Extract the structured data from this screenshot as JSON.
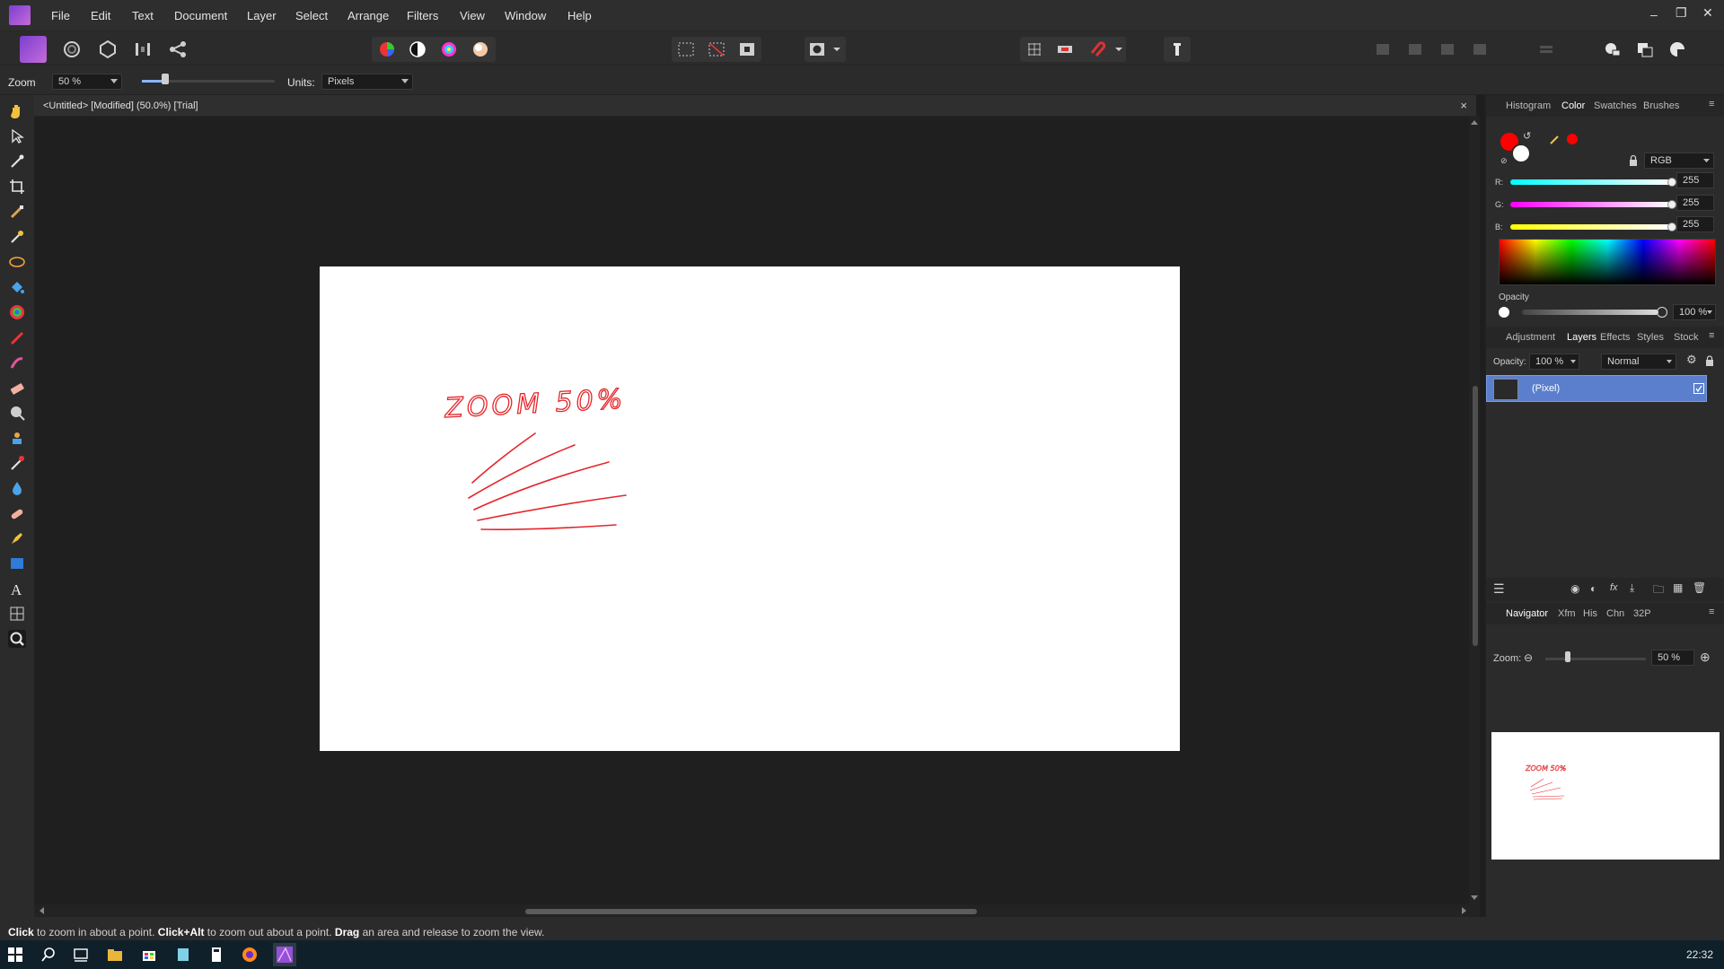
{
  "menu": {
    "items": [
      "File",
      "Edit",
      "Text",
      "Document",
      "Layer",
      "Select",
      "Arrange",
      "Filters",
      "View",
      "Window",
      "Help"
    ]
  },
  "context": {
    "zoom_label": "Zoom",
    "zoom_value": "50 %",
    "units_label": "Units:",
    "units_value": "Pixels"
  },
  "document": {
    "tab_title": "<Untitled> [Modified] (50.0%) [Trial]",
    "close_glyph": "×",
    "canvas_text": "ZOOM 50%"
  },
  "color_panel": {
    "tabs": [
      "Histogram",
      "Color",
      "Swatches",
      "Brushes"
    ],
    "active_tab": "Color",
    "model": "RGB",
    "r_label": "R:",
    "r_value": "255",
    "r_level": 1.0,
    "g_label": "G:",
    "g_value": "255",
    "g_level": 1.0,
    "b_label": "B:",
    "b_value": "255",
    "b_level": 1.0,
    "opacity_label": "Opacity",
    "opacity_value": "100 %",
    "primary_color": "#ff0000",
    "secondary_color": "#ffffff"
  },
  "layers_panel": {
    "tabs": [
      "Adjustment",
      "Layers",
      "Effects",
      "Styles",
      "Stock"
    ],
    "active_tab": "Layers",
    "opacity_label": "Opacity:",
    "opacity_value": "100 %",
    "blend_mode": "Normal",
    "layer_name": "(Pixel)"
  },
  "navigator_panel": {
    "tabs": [
      "Navigator",
      "Xfm",
      "His",
      "Chn",
      "32P"
    ],
    "active_tab": "Navigator",
    "zoom_label": "Zoom:",
    "zoom_value": "50 %",
    "preview_text": "ZOOM 50%"
  },
  "status": {
    "part1_bold": "Click",
    "part1": " to zoom in about a point. ",
    "part2_bold": "Click+Alt",
    "part2": " to zoom out about a point. ",
    "part3_bold": "Drag",
    "part3": " an area and release to zoom the view."
  },
  "taskbar": {
    "clock": "22:32"
  },
  "colors": {
    "accent": "#5b7fcc",
    "brand": "#8a44d6"
  }
}
